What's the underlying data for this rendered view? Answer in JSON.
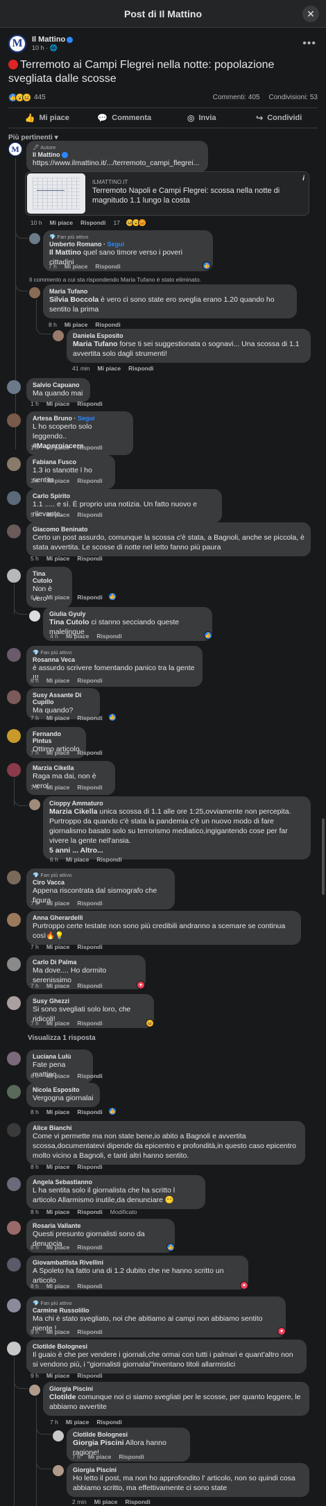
{
  "header": {
    "title": "Post di Il Mattino",
    "close": "✕"
  },
  "post": {
    "page_name": "Il Mattino",
    "logo_letter": "M",
    "meta": "10 h · 🌐",
    "title": "Terremoto ai Campi Flegrei nella notte: popolazione svegliata dalle scosse",
    "reactions_count": "445",
    "comments_count": "Commenti: 405",
    "shares_count": "Condivisioni: 53"
  },
  "actions": {
    "like": "Mi piace",
    "comment": "Commenta",
    "send": "Invia",
    "share": "Condividi"
  },
  "sort_label": "Più pertinenti ▾",
  "author_comment": {
    "badge": "🖋 Autore",
    "name": "Il Mattino",
    "link": "https://www.ilmattino.it/.../terremoto_campi_flegrei...",
    "preview_site": "ILMATTINO.IT",
    "preview_title": "Terremoto Napoli e Campi Flegrei: scossa nella notte di magnitudo 1.1 lungo la costa",
    "time": "10 h",
    "like": "Mi piace",
    "reply": "Rispondi",
    "reacts": "17"
  },
  "labels": {
    "like": "Mi piace",
    "reply": "Rispondi",
    "modified": "Modificato",
    "follow": "Segui",
    "fan": "💎 Fan più attivo"
  },
  "comments": [
    {
      "name": "Umberto Romano",
      "text_pre": "",
      "mention": "Il Mattino",
      "text": " quel sano timore verso i poveri cittadini",
      "time": "7 h"
    },
    {
      "deleted": "Il commento a cui sta rispondendo Maria Tufano è stato eliminato."
    },
    {
      "name": "Maria Tufano",
      "mention": "Silvia Boccola",
      "text": " è vero ci sono state ero sveglia erano 1.20 quando ho sentito la prima",
      "time": "8 h"
    },
    {
      "name": "Daniela Esposito",
      "mention": "Maria Tufano",
      "text": " forse ti sei suggestionata o sognavi... Una scossa di 1.1 avvertita solo dagli strumenti!",
      "time": "41 min"
    },
    {
      "name": "Salvio Capuano",
      "text": "Ma quando mai",
      "time": "1 h"
    },
    {
      "name": "Artesa Bruno",
      "text": "L ho scoperto solo leggendo..",
      "hashtag": "#Maperpiacere",
      "time": "1 h"
    },
    {
      "name": "Fabiana Fusco",
      "text": "1.3 io stanotte l ho sentita",
      "time": "3 h"
    },
    {
      "name": "Carlo Spirito",
      "text": "1.1 ..... e sì. È proprio una notizia. Un fatto nuovo e rilevante.",
      "time": "5 h"
    },
    {
      "name": "Giacomo Beninato",
      "text": "Certo un post assurdo, comunque la scossa c'è stata, a Bagnoli, anche se piccola, è stata avvertita. Le scosse di notte nel letto fanno più paura",
      "time": "5 h"
    },
    {
      "name": "Tina Cutolo",
      "text": "Non è vero",
      "time": "6 h"
    },
    {
      "name": "Giulia Gyuly",
      "mention": "Tina Cutolo",
      "text": " ci stanno secciando queste malelingue",
      "time": "4 h"
    },
    {
      "name": "Rosanna Veca",
      "text": "è assurdo scrivere fomentando panico tra la gente !!!",
      "time": "6 h"
    },
    {
      "name": "Susy Assante Di Cupillo",
      "text": "Ma quando?",
      "time": "7 h"
    },
    {
      "name": "Fernando Pintus",
      "text": "Ottimo articolo",
      "time": "7 h"
    },
    {
      "name": "Marzia Cikella",
      "text": "Raga ma dai, non è vero!",
      "time": "7 h"
    },
    {
      "name": "Cioppy Ammaturo",
      "mention": "Marzia Cikella",
      "text": " unica scossa di 1.1 alle ore 1:25,ovviamente non percepita. Purtroppo da quando c'è stata la pandemia c'è un nuovo modo di fare giornalismo basato solo su terrorismo mediatico,ingigantendo cose per far vivere la gente nell'ansia.",
      "more": "5 anni ... Altro...",
      "time": "6 h"
    },
    {
      "name": "Ciro Vacca",
      "text": "Appena riscontrata dal sismografo che figura",
      "time": "7 h"
    },
    {
      "name": "Anna Gherardelli",
      "text": "Purtroppo certe testate non sono più credibili andranno a scemare se continua così🔥💡",
      "time": "7 h"
    },
    {
      "name": "Carlo Di Palma",
      "text": "Ma dove.... Ho dormito serenissimo",
      "time": "7 h"
    },
    {
      "name": "Susy Ghezzi",
      "text": "Si sono svegliati solo loro, che ridicoli!",
      "time": "7 h"
    },
    {
      "view_replies": "Visualizza 1 risposta"
    },
    {
      "name": "Luciana Lulù",
      "text": "Fate pena mattino",
      "time": "8 h"
    },
    {
      "name": "Nicola Esposito",
      "text": "Vergogna giornalai",
      "time": "8 h"
    },
    {
      "name": "Alice Bianchi",
      "text": "Come vi permette ma non state bene,io abito a Bagnoli e avvertita scossa,documentatevi dipende da epicentro e profondità,in questo caso epicentro molto vicino a Bagnoli, e tanti altri hanno sentito.",
      "time": "8 h"
    },
    {
      "name": "Angela Sebastianno",
      "text": "L ha sentita solo il giornalista che ha scritto l articolo Allarmismo inutile,da denunciare 😶",
      "time": "8 h"
    },
    {
      "name": "Rosaria Vallante",
      "text": "Questi presunto giornalisti sono da denuncia",
      "time": "8 h"
    },
    {
      "name": "Giovambattista Rivellini",
      "text": "A Spoleto ha fatto una di 1.2 dubito che ne hanno scritto un articolo",
      "time": "8 h"
    },
    {
      "name": "Carmine Russolillo",
      "text": "Ma chi è stato svegliato, noi che abitiamo ai campi non abbiamo sentito niente !",
      "time": "9 h"
    },
    {
      "name": "Clotilde Bolognesi",
      "text": "Il guaio è che per vendere i giornali,che ormai con tutti i palmari e quant'altro non si vendono più, i \"giornalisti giornalai\"inventano titoli allarmistici",
      "time": "9 h"
    },
    {
      "name": "Giorgia Piscini",
      "mention": "Clotilde",
      "text": " comunque noi ci siamo svegliati per le scosse, per quanto leggere, le abbiamo avvertite",
      "time": "7 h"
    },
    {
      "name": "Clotilde Bolognesi",
      "mention": "Giorgia Piscini",
      "text": " Allora hanno ragione!",
      "time": "7 h"
    },
    {
      "name": "Giorgia Piscini",
      "text": "Ho letto il post, ma non ho approfondito l' articolo, non so quindi cosa abbiamo scritto, ma effettivamente ci sono state",
      "time": "2 min"
    }
  ],
  "colors": {
    "like_blue": "#2d88ff",
    "love_red": "#f33e58",
    "haha_yellow": "#f7b928",
    "bg": "#18191a",
    "bubble": "#3a3b3c"
  }
}
